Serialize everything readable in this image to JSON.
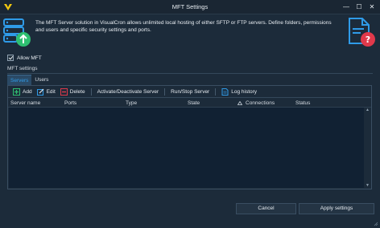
{
  "window": {
    "title": "MFT Settings",
    "minimize_glyph": "—",
    "maximize_glyph": "☐",
    "close_glyph": "✕"
  },
  "header": {
    "description": "The MFT Server solution in VisualCron allows unlimited local hosting of either SFTP or FTP servers. Define folders, permissions and users and specific security settings and ports.",
    "left_icon": "server-upload-icon",
    "right_icon": "document-help-icon"
  },
  "allow_mft": {
    "label": "Allow MFT",
    "checked": true
  },
  "section": {
    "label": "MFT settings"
  },
  "tabs": [
    {
      "label": "Servers",
      "active": true
    },
    {
      "label": "Users",
      "active": false
    }
  ],
  "toolbar": {
    "add": "Add",
    "edit": "Edit",
    "delete": "Delete",
    "activate": "Activate/Deactivate Server",
    "run_stop": "Run/Stop Server",
    "log_history": "Log history"
  },
  "grid": {
    "columns": [
      "Server name",
      "Ports",
      "Type",
      "State",
      "Connections",
      "Status"
    ],
    "rows": []
  },
  "buttons": {
    "cancel": "Cancel",
    "apply": "Apply settings"
  },
  "colors": {
    "background": "#1c2b3a",
    "accent": "#2f9be8",
    "grid_body": "#112133",
    "success": "#2fbf71",
    "danger": "#e0394b"
  }
}
